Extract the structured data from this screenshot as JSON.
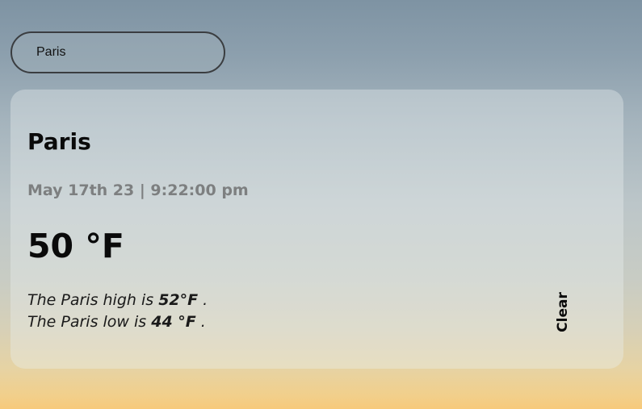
{
  "search": {
    "value": "Paris"
  },
  "weather": {
    "city": "Paris",
    "datetime": "May 17th 23 | 9:22:00 pm",
    "temperature": "50 °F",
    "high_prefix": "The Paris high is ",
    "high_value": "52°F",
    "high_suffix": " .",
    "low_prefix": "The Paris low is ",
    "low_value": "44 °F",
    "low_suffix": " ."
  },
  "actions": {
    "clear_label": "Clear"
  },
  "colors": {
    "sky_top": "#7e93a3",
    "horizon": "#f7c97a",
    "muted_text": "#7d7f80"
  }
}
